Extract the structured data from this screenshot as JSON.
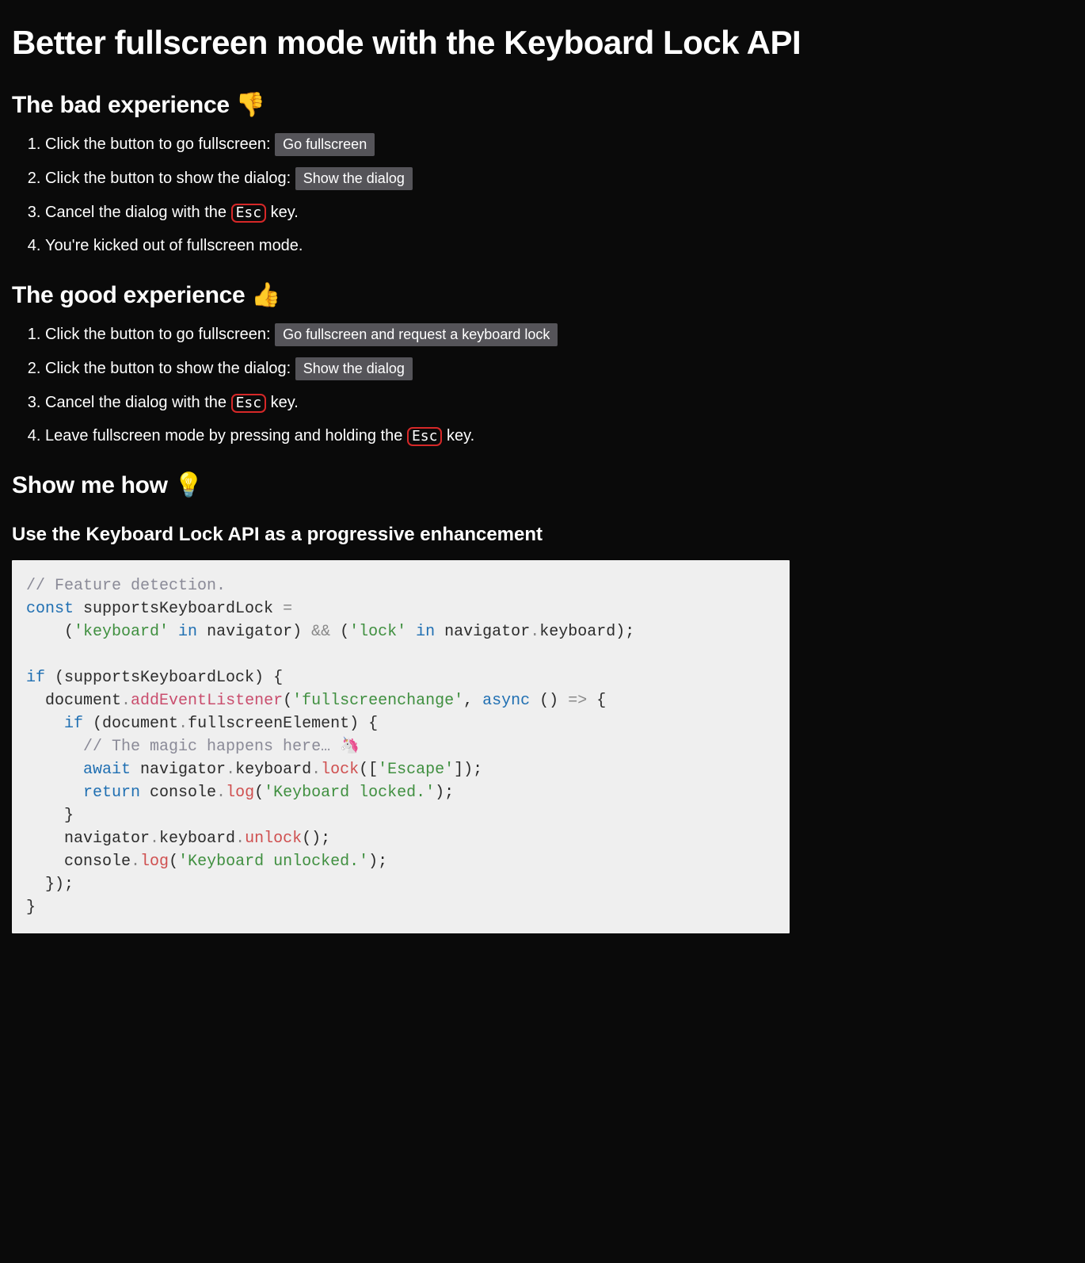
{
  "title": "Better fullscreen mode with the Keyboard Lock API",
  "bad": {
    "heading": "The bad experience 👎",
    "step1_pre": "Click the button to go fullscreen: ",
    "step1_btn": "Go fullscreen",
    "step2_pre": "Click the button to show the dialog: ",
    "step2_btn": "Show the dialog",
    "step3_pre": "Cancel the dialog with the ",
    "step3_key": "Esc",
    "step3_post": " key.",
    "step4": "You're kicked out of fullscreen mode."
  },
  "good": {
    "heading": "The good experience 👍",
    "step1_pre": "Click the button to go fullscreen: ",
    "step1_btn": "Go fullscreen and request a keyboard lock",
    "step2_pre": "Click the button to show the dialog: ",
    "step2_btn": "Show the dialog",
    "step3_pre": "Cancel the dialog with the ",
    "step3_key": "Esc",
    "step3_post": " key.",
    "step4_pre": "Leave fullscreen mode by pressing and holding the ",
    "step4_key": "Esc",
    "step4_post": " key."
  },
  "how": {
    "heading": "Show me how 💡",
    "subheading": "Use the Keyboard Lock API as a progressive enhancement"
  },
  "code": {
    "c1": "// Feature detection.",
    "kw_const": "const",
    "v_supports": " supportsKeyboardLock ",
    "op_eq": "=",
    "l2_a": "    (",
    "s_keyboard": "'keyboard'",
    "kw_in1": " in ",
    "v_nav1": "navigator",
    "l2_b": ") ",
    "op_and": "&&",
    "l2_c": " (",
    "s_lock": "'lock'",
    "kw_in2": " in ",
    "v_nav2": "navigator",
    "dot1": ".",
    "v_kbd1": "keyboard",
    "l2_d": ");",
    "kw_if1": "if",
    "if1_a": " (supportsKeyboardLock) {",
    "l5_a": "  document",
    "dot2": ".",
    "m_add": "addEventListener",
    "l5_b": "(",
    "s_fsc": "'fullscreenchange'",
    "l5_c": ", ",
    "kw_async": "async",
    "l5_d": " () ",
    "op_arrow": "=>",
    "l5_e": " {",
    "l6_a": "    ",
    "kw_if2": "if",
    "l6_b": " (document",
    "dot3": ".",
    "v_fse": "fullscreenElement",
    "l6_c": ") {",
    "l7_a": "      ",
    "c2": "// The magic happens here… 🦄",
    "l8_a": "      ",
    "kw_await": "await",
    "l8_b": " navigator",
    "dot4": ".",
    "v_kbd2": "keyboard",
    "dot5": ".",
    "m_lock": "lock",
    "l8_c": "([",
    "s_escape": "'Escape'",
    "l8_d": "]);",
    "l9_a": "      ",
    "kw_return": "return",
    "l9_b": " console",
    "dot6": ".",
    "m_log1": "log",
    "l9_c": "(",
    "s_locked": "'Keyboard locked.'",
    "l9_d": ");",
    "l10": "    }",
    "l11_a": "    navigator",
    "dot7": ".",
    "v_kbd3": "keyboard",
    "dot8": ".",
    "m_unlock": "unlock",
    "l11_b": "();",
    "l12_a": "    console",
    "dot9": ".",
    "m_log2": "log",
    "l12_b": "(",
    "s_unlocked": "'Keyboard unlocked.'",
    "l12_c": ");",
    "l13": "  });",
    "l14": "}"
  }
}
